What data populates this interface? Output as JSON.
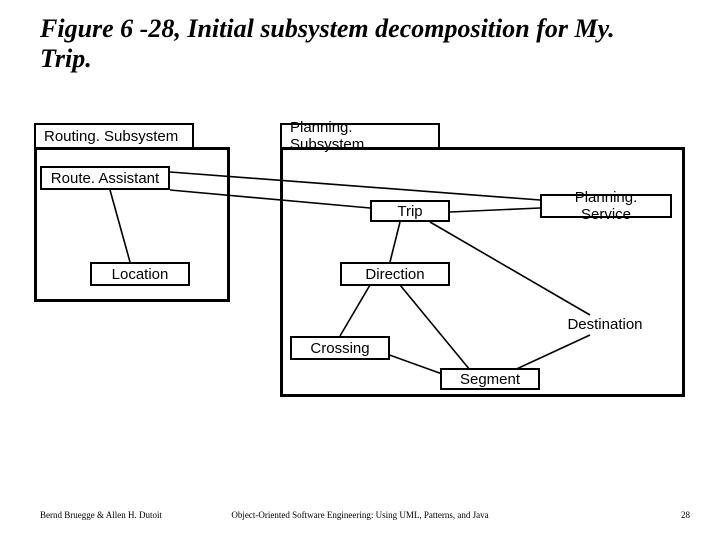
{
  "title": "Figure 6 -28, Initial subsystem decomposition for My. Trip.",
  "packages": {
    "routing_tab": "Routing. Subsystem",
    "planning_tab": "Planning. Subsystem"
  },
  "classes": {
    "route_assistant": "Route. Assistant",
    "planning_service": "Planning. Service",
    "trip": "Trip",
    "location": "Location",
    "direction": "Direction",
    "destination": "Destination",
    "crossing": "Crossing",
    "segment": "Segment"
  },
  "footer": {
    "left": "Bernd Bruegge & Allen H. Dutoit",
    "center": "Object-Oriented Software Engineering: Using UML, Patterns, and Java",
    "right": "28"
  },
  "chart_data": {
    "type": "diagram",
    "title": "Figure 6-28, Initial subsystem decomposition for MyTrip.",
    "packages": [
      {
        "name": "RoutingSubsystem",
        "contains": [
          "RouteAssistant",
          "Location"
        ]
      },
      {
        "name": "PlanningSubsystem",
        "contains": [
          "PlanningService",
          "Trip",
          "Direction",
          "Destination",
          "Crossing",
          "Segment"
        ]
      }
    ],
    "nodes": [
      "RouteAssistant",
      "PlanningService",
      "Trip",
      "Location",
      "Direction",
      "Destination",
      "Crossing",
      "Segment"
    ],
    "edges": [
      [
        "RouteAssistant",
        "Trip"
      ],
      [
        "RouteAssistant",
        "Location"
      ],
      [
        "RouteAssistant",
        "PlanningService"
      ],
      [
        "PlanningService",
        "Trip"
      ],
      [
        "Trip",
        "Direction"
      ],
      [
        "Trip",
        "Destination"
      ],
      [
        "Direction",
        "Crossing"
      ],
      [
        "Direction",
        "Segment"
      ],
      [
        "Crossing",
        "Segment"
      ],
      [
        "Destination",
        "Segment"
      ]
    ]
  }
}
